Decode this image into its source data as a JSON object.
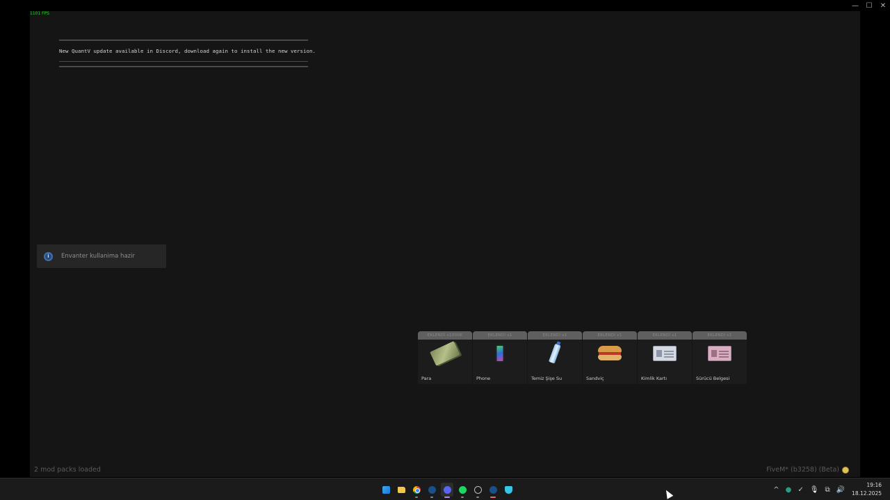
{
  "window": {
    "controls": [
      "—",
      "☐",
      "✕"
    ]
  },
  "game": {
    "fps": "1101 FPS",
    "notice": "New QuantV update available in Discord, download again to install the new version.",
    "toast": "Envanter kullanima hazir",
    "footer_left": "2 mod packs loaded",
    "footer_right": "FiveM* (b3258) (Beta)"
  },
  "hotbar": {
    "slots": [
      {
        "head": "EKLENDİ x1000K",
        "label": "Para",
        "icon": "money-icon"
      },
      {
        "head": "EKLENDİ x1",
        "label": "Phone",
        "icon": "phone-icon"
      },
      {
        "head": "EKLENDİ x1",
        "label": "Temiz Şişe Su",
        "icon": "water-bottle-icon"
      },
      {
        "head": "EKLENDİ x1",
        "label": "Sandviç",
        "icon": "sandwich-icon"
      },
      {
        "head": "EKLENDİ x1",
        "label": "Kimlik Kartı",
        "icon": "id-card-icon"
      },
      {
        "head": "EKLENDİ x1",
        "label": "Sürücü Belgesi",
        "icon": "driver-license-icon"
      }
    ]
  },
  "taskbar": {
    "apps": [
      "windows-start",
      "file-explorer",
      "chrome",
      "steam",
      "discord",
      "spotify",
      "app-circle",
      "steam-2",
      "vpn-shield"
    ],
    "tray": [
      "^",
      "●",
      "✓",
      "🎙",
      "⧉",
      "🔊"
    ],
    "time": "19:16",
    "date": "18.12.2025"
  },
  "colors": {
    "fps_green": "#29d22e",
    "toast_icon": "#3f6fb0",
    "discord_active": "#b38be6"
  }
}
